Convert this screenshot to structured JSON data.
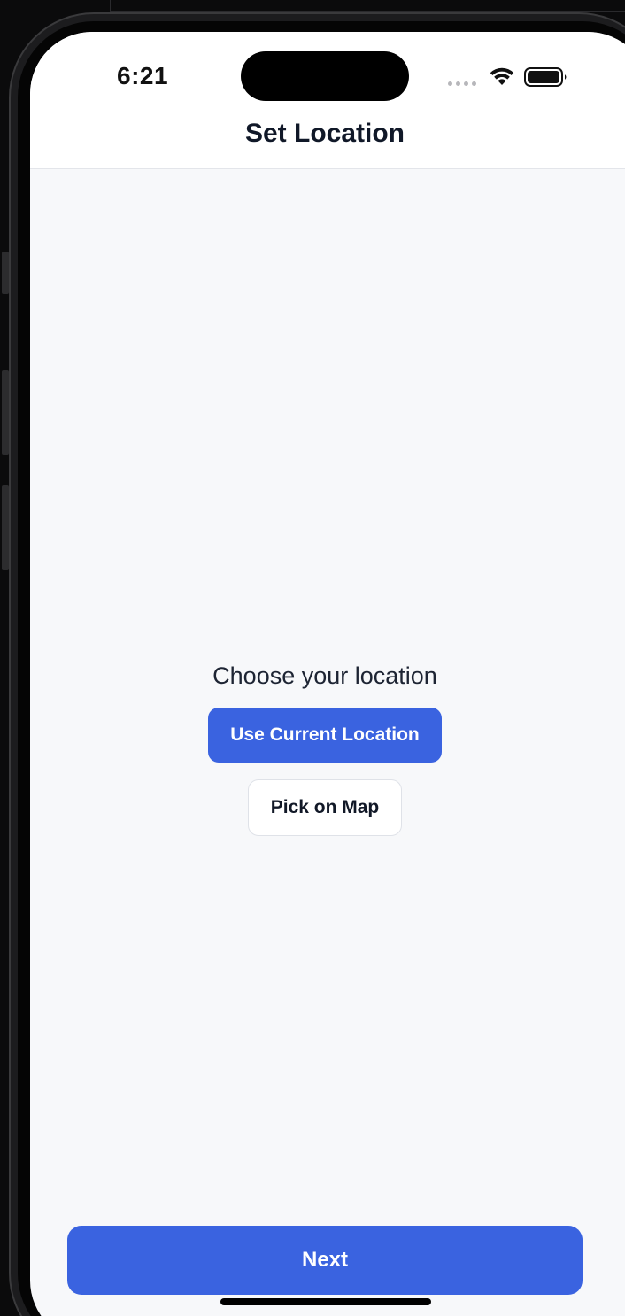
{
  "status_bar": {
    "time": "6:21",
    "icons": [
      "signal-dots-icon",
      "wifi-icon",
      "battery-icon"
    ]
  },
  "header": {
    "title": "Set Location"
  },
  "main": {
    "prompt": "Choose your location",
    "use_current_label": "Use Current Location",
    "pick_on_map_label": "Pick on Map"
  },
  "footer": {
    "next_label": "Next"
  },
  "colors": {
    "accent": "#3a63e0",
    "background": "#f7f8fa",
    "title_text": "#101828"
  }
}
